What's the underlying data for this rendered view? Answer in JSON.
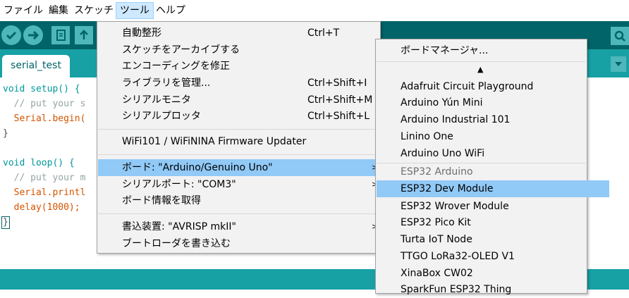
{
  "menubar": [
    "ファイル",
    "編集",
    "スケッチ",
    "ツール",
    "ヘルプ"
  ],
  "tab": {
    "label": "serial_test"
  },
  "code": {
    "l1": "void setup() {",
    "l2": "  // put your s",
    "l3": "  Serial.begin(",
    "l4": "}",
    "l6": "void loop() {",
    "l7": "  // put your m",
    "l8": "  Serial.printl",
    "l9": "  delay(1000);",
    "l10": "}"
  },
  "tools_menu": {
    "items": [
      {
        "label": "自動整形",
        "shortcut": "Ctrl+T"
      },
      {
        "label": "スケッチをアーカイブする",
        "shortcut": ""
      },
      {
        "label": "エンコーディングを修正",
        "shortcut": ""
      },
      {
        "label": "ライブラリを管理...",
        "shortcut": "Ctrl+Shift+I"
      },
      {
        "label": "シリアルモニタ",
        "shortcut": "Ctrl+Shift+M"
      },
      {
        "label": "シリアルプロッタ",
        "shortcut": "Ctrl+Shift+L"
      },
      {
        "label": "WiFi101 / WiFiNINA Firmware Updater",
        "shortcut": ""
      },
      {
        "label": "ボード: \"Arduino/Genuino Uno\"",
        "shortcut": ""
      },
      {
        "label": "シリアルポート: \"COM3\"",
        "shortcut": ""
      },
      {
        "label": "ボード情報を取得",
        "shortcut": ""
      },
      {
        "label": "書込装置: \"AVRISP mkII\"",
        "shortcut": ""
      },
      {
        "label": "ブートローダを書き込む",
        "shortcut": ""
      }
    ],
    "arrow": ">"
  },
  "board_menu": {
    "manager": "ボードマネージャ...",
    "scroll_up": "▲",
    "items": [
      "Adafruit Circuit Playground",
      "Arduino Yún Mini",
      "Arduino Industrial 101",
      "Linino One",
      "Arduino Uno WiFi",
      "ESP32 Arduino",
      "ESP32 Dev Module",
      "ESP32 Wrover Module",
      "ESP32 Pico Kit",
      "Turta IoT Node",
      "TTGO LoRa32-OLED V1",
      "XinaBox CW02",
      "SparkFun ESP32 Thing"
    ]
  },
  "colors": {
    "toolbar": "#006468",
    "tabbar": "#17a1a5",
    "highlight": "#91c9f7"
  }
}
